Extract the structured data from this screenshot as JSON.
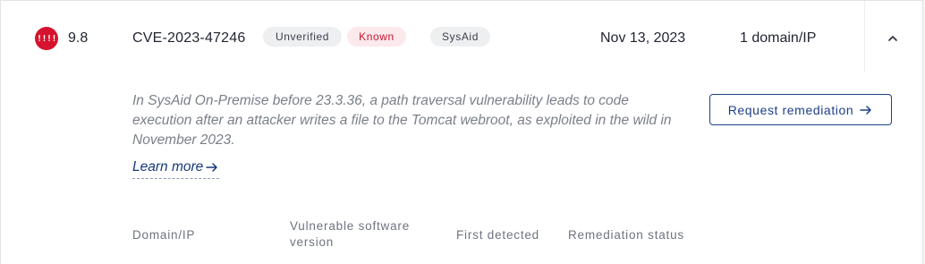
{
  "finding": {
    "severity_icon": "critical-severity-icon",
    "severity_glyph": "!!!!",
    "score": "9.8",
    "cve_id": "CVE-2023-47246",
    "badges": {
      "verification": "Unverified",
      "exploit_status": "Known",
      "vendor": "SysAid"
    },
    "date": "Nov 13, 2023",
    "affected": "1 domain/IP",
    "toggle_icon": "chevron-up-icon"
  },
  "details": {
    "description": "In SysAid On-Premise before 23.3.36, a path traversal vulnerability leads to code execution after an attacker writes a file to the Tomcat webroot, as exploited in the wild in November 2023.",
    "learn_more": "Learn more",
    "learn_more_icon": "arrow-right-icon",
    "request_button": "Request remediation",
    "request_button_icon": "arrow-right-icon"
  },
  "table": {
    "headers": [
      "Domain/IP",
      "Vulnerable software version",
      "First detected",
      "Remediation status"
    ]
  },
  "colors": {
    "critical": "#d6132f",
    "known_badge_bg": "#fbe9ec",
    "known_badge_text": "#c4152f",
    "accent": "#1d3f8a"
  }
}
